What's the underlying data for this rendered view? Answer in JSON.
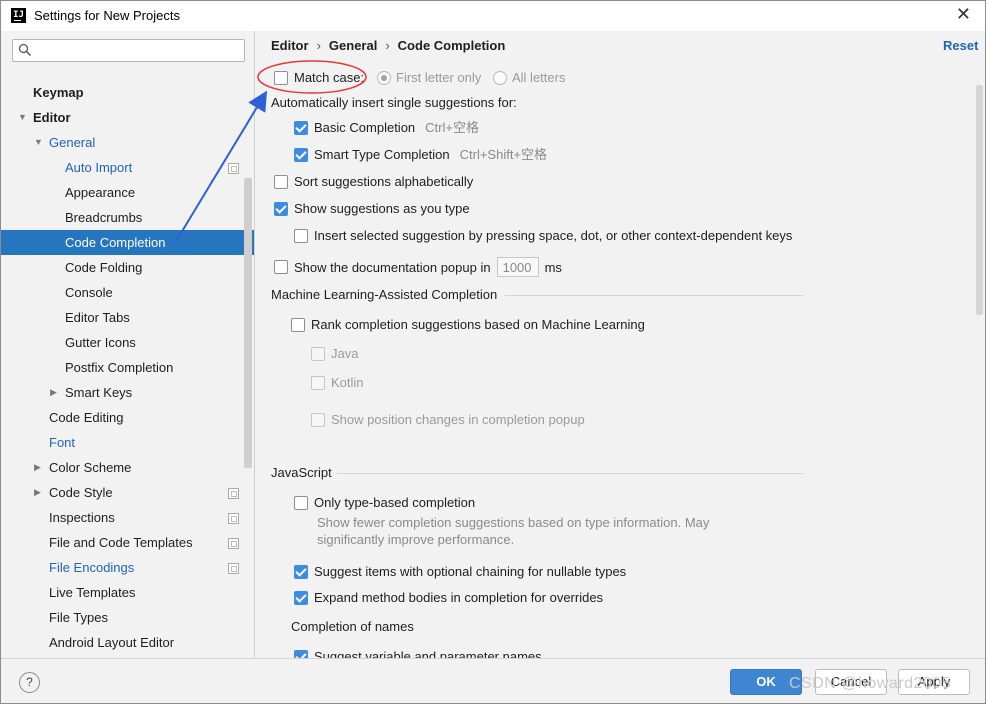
{
  "window": {
    "title": "Settings for New Projects",
    "close_glyph": "✕"
  },
  "search": {
    "placeholder": ""
  },
  "tree": [
    {
      "label": "Keymap",
      "bold": true
    },
    {
      "label": "Editor",
      "bold": true
    },
    {
      "label": "General"
    },
    {
      "label": "Auto Import"
    },
    {
      "label": "Appearance"
    },
    {
      "label": "Breadcrumbs"
    },
    {
      "label": "Code Completion"
    },
    {
      "label": "Code Folding"
    },
    {
      "label": "Console"
    },
    {
      "label": "Editor Tabs"
    },
    {
      "label": "Gutter Icons"
    },
    {
      "label": "Postfix Completion"
    },
    {
      "label": "Smart Keys"
    },
    {
      "label": "Code Editing"
    },
    {
      "label": "Font"
    },
    {
      "label": "Color Scheme"
    },
    {
      "label": "Code Style"
    },
    {
      "label": "Inspections"
    },
    {
      "label": "File and Code Templates"
    },
    {
      "label": "File Encodings"
    },
    {
      "label": "Live Templates"
    },
    {
      "label": "File Types"
    },
    {
      "label": "Android Layout Editor"
    }
  ],
  "breadcrumb": {
    "items": [
      "Editor",
      "General",
      "Code Completion"
    ],
    "sep": "›"
  },
  "reset_label": "Reset",
  "options": {
    "match_case": {
      "label": "Match case:",
      "checked": false
    },
    "first_letter_only": "First letter only",
    "all_letters": "All letters",
    "auto_insert_heading": "Automatically insert single suggestions for:",
    "basic_completion": {
      "label": "Basic Completion",
      "shortcut": "Ctrl+空格",
      "checked": true
    },
    "smart_type_completion": {
      "label": "Smart Type Completion",
      "shortcut": "Ctrl+Shift+空格",
      "checked": true
    },
    "sort_alphabetically": {
      "label": "Sort suggestions alphabetically",
      "checked": false
    },
    "show_as_you_type": {
      "label": "Show suggestions as you type",
      "checked": true
    },
    "insert_by_space": {
      "label": "Insert selected suggestion by pressing space, dot, or other context-dependent keys",
      "checked": false
    },
    "doc_popup": {
      "label": "Show the documentation popup in",
      "value": "1000",
      "unit": "ms",
      "checked": false
    }
  },
  "ml_section": {
    "title": "Machine Learning-Assisted Completion",
    "rank": "Rank completion suggestions based on Machine Learning",
    "java": "Java",
    "kotlin": "Kotlin",
    "position_changes": "Show position changes in completion popup"
  },
  "js_section": {
    "title": "JavaScript",
    "only_type_based": "Only type-based completion",
    "desc_line1": "Show fewer completion suggestions based on type information. May",
    "desc_line2": "significantly improve performance.",
    "optional_chaining": "Suggest items with optional chaining for nullable types",
    "expand_method": "Expand method bodies in completion for overrides",
    "completion_of_names": "Completion of names",
    "suggest_variable": "Suggest variable and parameter names"
  },
  "footer": {
    "help": "?",
    "ok": "OK",
    "cancel": "Cancel",
    "apply": "Apply"
  },
  "watermark": "CSDN @howard2005",
  "colors": {
    "accent": "#2675bf",
    "link": "#2264b4",
    "annotation": "#e03a3a",
    "arrow": "#2d5fd6"
  }
}
